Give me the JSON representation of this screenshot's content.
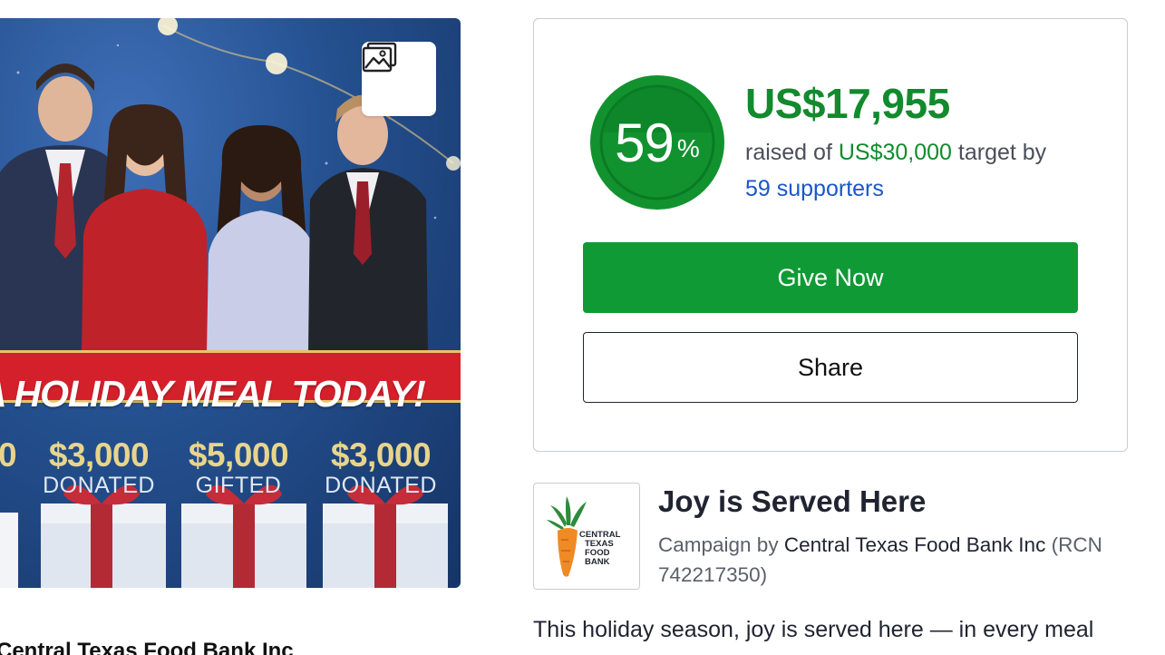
{
  "hero": {
    "banner_text": "A HOLIDAY MEAL TODAY!",
    "partial_left_amount": "0",
    "stats": [
      {
        "amount": "$3,000",
        "label": "DONATED"
      },
      {
        "amount": "$5,000",
        "label": "GIFTED"
      },
      {
        "amount": "$3,000",
        "label": "DONATED"
      }
    ],
    "gallery_icon": "image-gallery-icon"
  },
  "org_name_peek": "Central Texas Food Bank Inc",
  "donation": {
    "percent": 59,
    "percent_label": "59",
    "percent_sign": "%",
    "raised_amount": "US$17,955",
    "raised_of_prefix": "raised of ",
    "goal_amount": "US$30,000",
    "target_by": " target by",
    "supporters": "59 supporters",
    "give_label": "Give Now",
    "share_label": "Share",
    "accent_color": "#128a2d",
    "button_color": "#0f9a35",
    "link_color": "#1a56c9"
  },
  "campaign": {
    "logo_text_lines": [
      "CENTRAL",
      "TEXAS",
      "FOOD",
      "BANK"
    ],
    "title": "Joy is Served Here",
    "by_prefix": "Campaign by ",
    "organization": "Central Texas Food Bank Inc",
    "rcn": " (RCN 742217350)",
    "description_start": "This holiday season, joy is served here — in every meal"
  }
}
